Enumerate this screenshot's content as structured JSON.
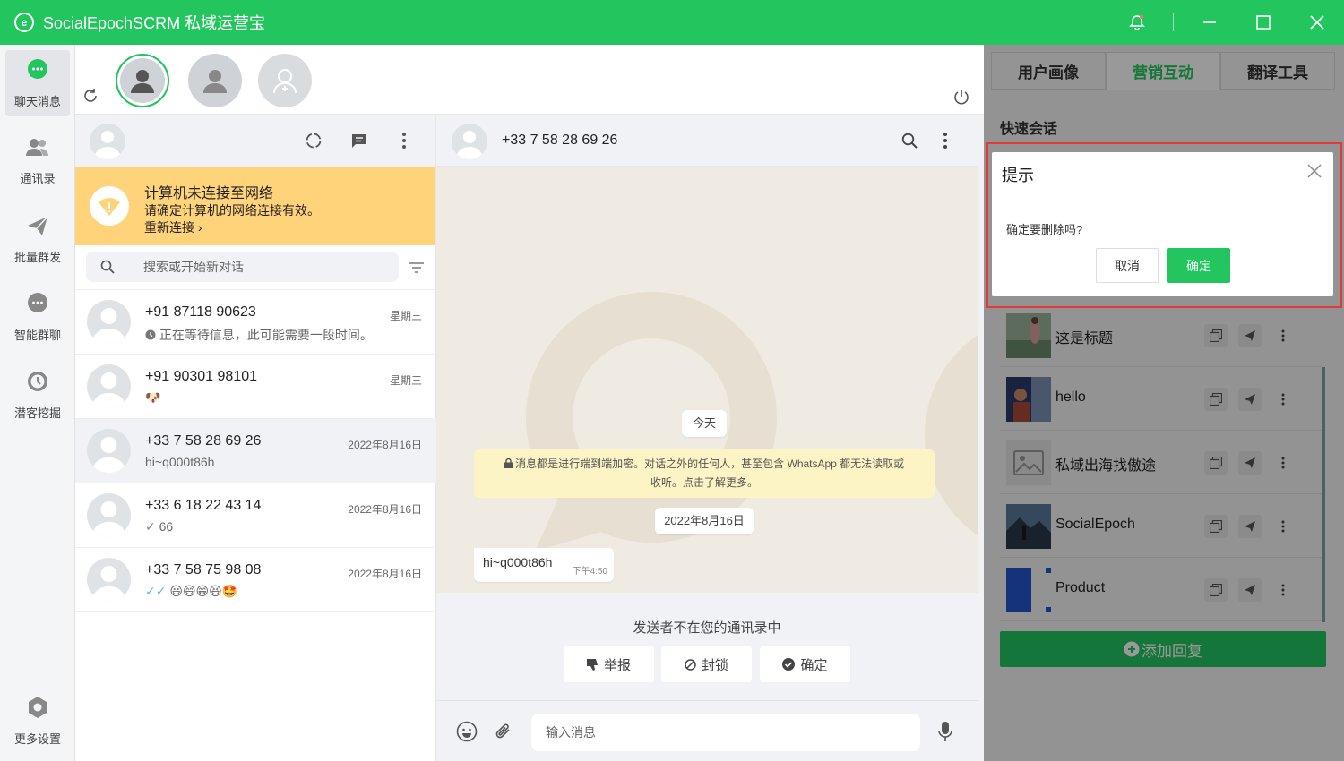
{
  "app": {
    "title": "SocialEpochSCRM 私域运营宝",
    "logo_letter": "e"
  },
  "nav": {
    "items": [
      {
        "label": "聊天消息",
        "icon": "chat-bubble-icon"
      },
      {
        "label": "通讯录",
        "icon": "contacts-icon"
      },
      {
        "label": "批量群发",
        "icon": "send-plane-icon"
      },
      {
        "label": "智能群聊",
        "icon": "group-chat-icon"
      },
      {
        "label": "潜客挖掘",
        "icon": "clock-icon"
      }
    ],
    "settings_label": "更多设置"
  },
  "chatlist": {
    "warning": {
      "title": "计算机未连接至网络",
      "desc": "请确定计算机的网络连接有效。",
      "action": "重新连接 ›"
    },
    "search_placeholder": "搜索或开始新对话",
    "chats": [
      {
        "name": "+91 87118 90623",
        "date": "星期三",
        "preview": "正在等待信息，此可能需要一段时间。"
      },
      {
        "name": "+91 90301 98101",
        "date": "星期三",
        "preview": "🐶"
      },
      {
        "name": "+33 7 58 28 69 26",
        "date": "2022年8月16日",
        "preview": "hi~q000t86h"
      },
      {
        "name": "+33 6 18 22 43 14",
        "date": "2022年8月16日",
        "preview": "66"
      },
      {
        "name": "+33 7 58 75 98 08",
        "date": "2022年8月16日",
        "preview": "😃😄😁😆🤩"
      }
    ]
  },
  "conversation": {
    "contact": "+33 7 58 28 69 26",
    "today_label": "今天",
    "encryption_line1": "消息都是进行端到端加密。对话之外的任何人，甚至包含 WhatsApp 都无法读取或",
    "encryption_line2": "收听。点击了解更多。",
    "date_label": "2022年8月16日",
    "message": {
      "text": "hi~q000t86h",
      "time": "下午4:50"
    },
    "unknown_sender": "发送者不在您的通讯录中",
    "buttons": {
      "report": "举报",
      "block": "封锁",
      "ok": "确定"
    },
    "input_placeholder": "输入消息"
  },
  "right_panel": {
    "tabs": [
      "用户画像",
      "营销互动",
      "翻译工具"
    ],
    "active_tab": "营销互动",
    "section_title": "快速会话",
    "replies": [
      {
        "label": "这是标题"
      },
      {
        "label": "hello"
      },
      {
        "label": "私域出海找傲途"
      },
      {
        "label": "SocialEpoch"
      },
      {
        "label": "Product"
      }
    ],
    "add_reply": "添加回复"
  },
  "dialog": {
    "title": "提示",
    "message": "确定要删除吗?",
    "cancel": "取消",
    "confirm": "确定"
  },
  "colors": {
    "brand": "#22c55e",
    "warning": "#ffd37a",
    "highlight": "#e53935"
  }
}
